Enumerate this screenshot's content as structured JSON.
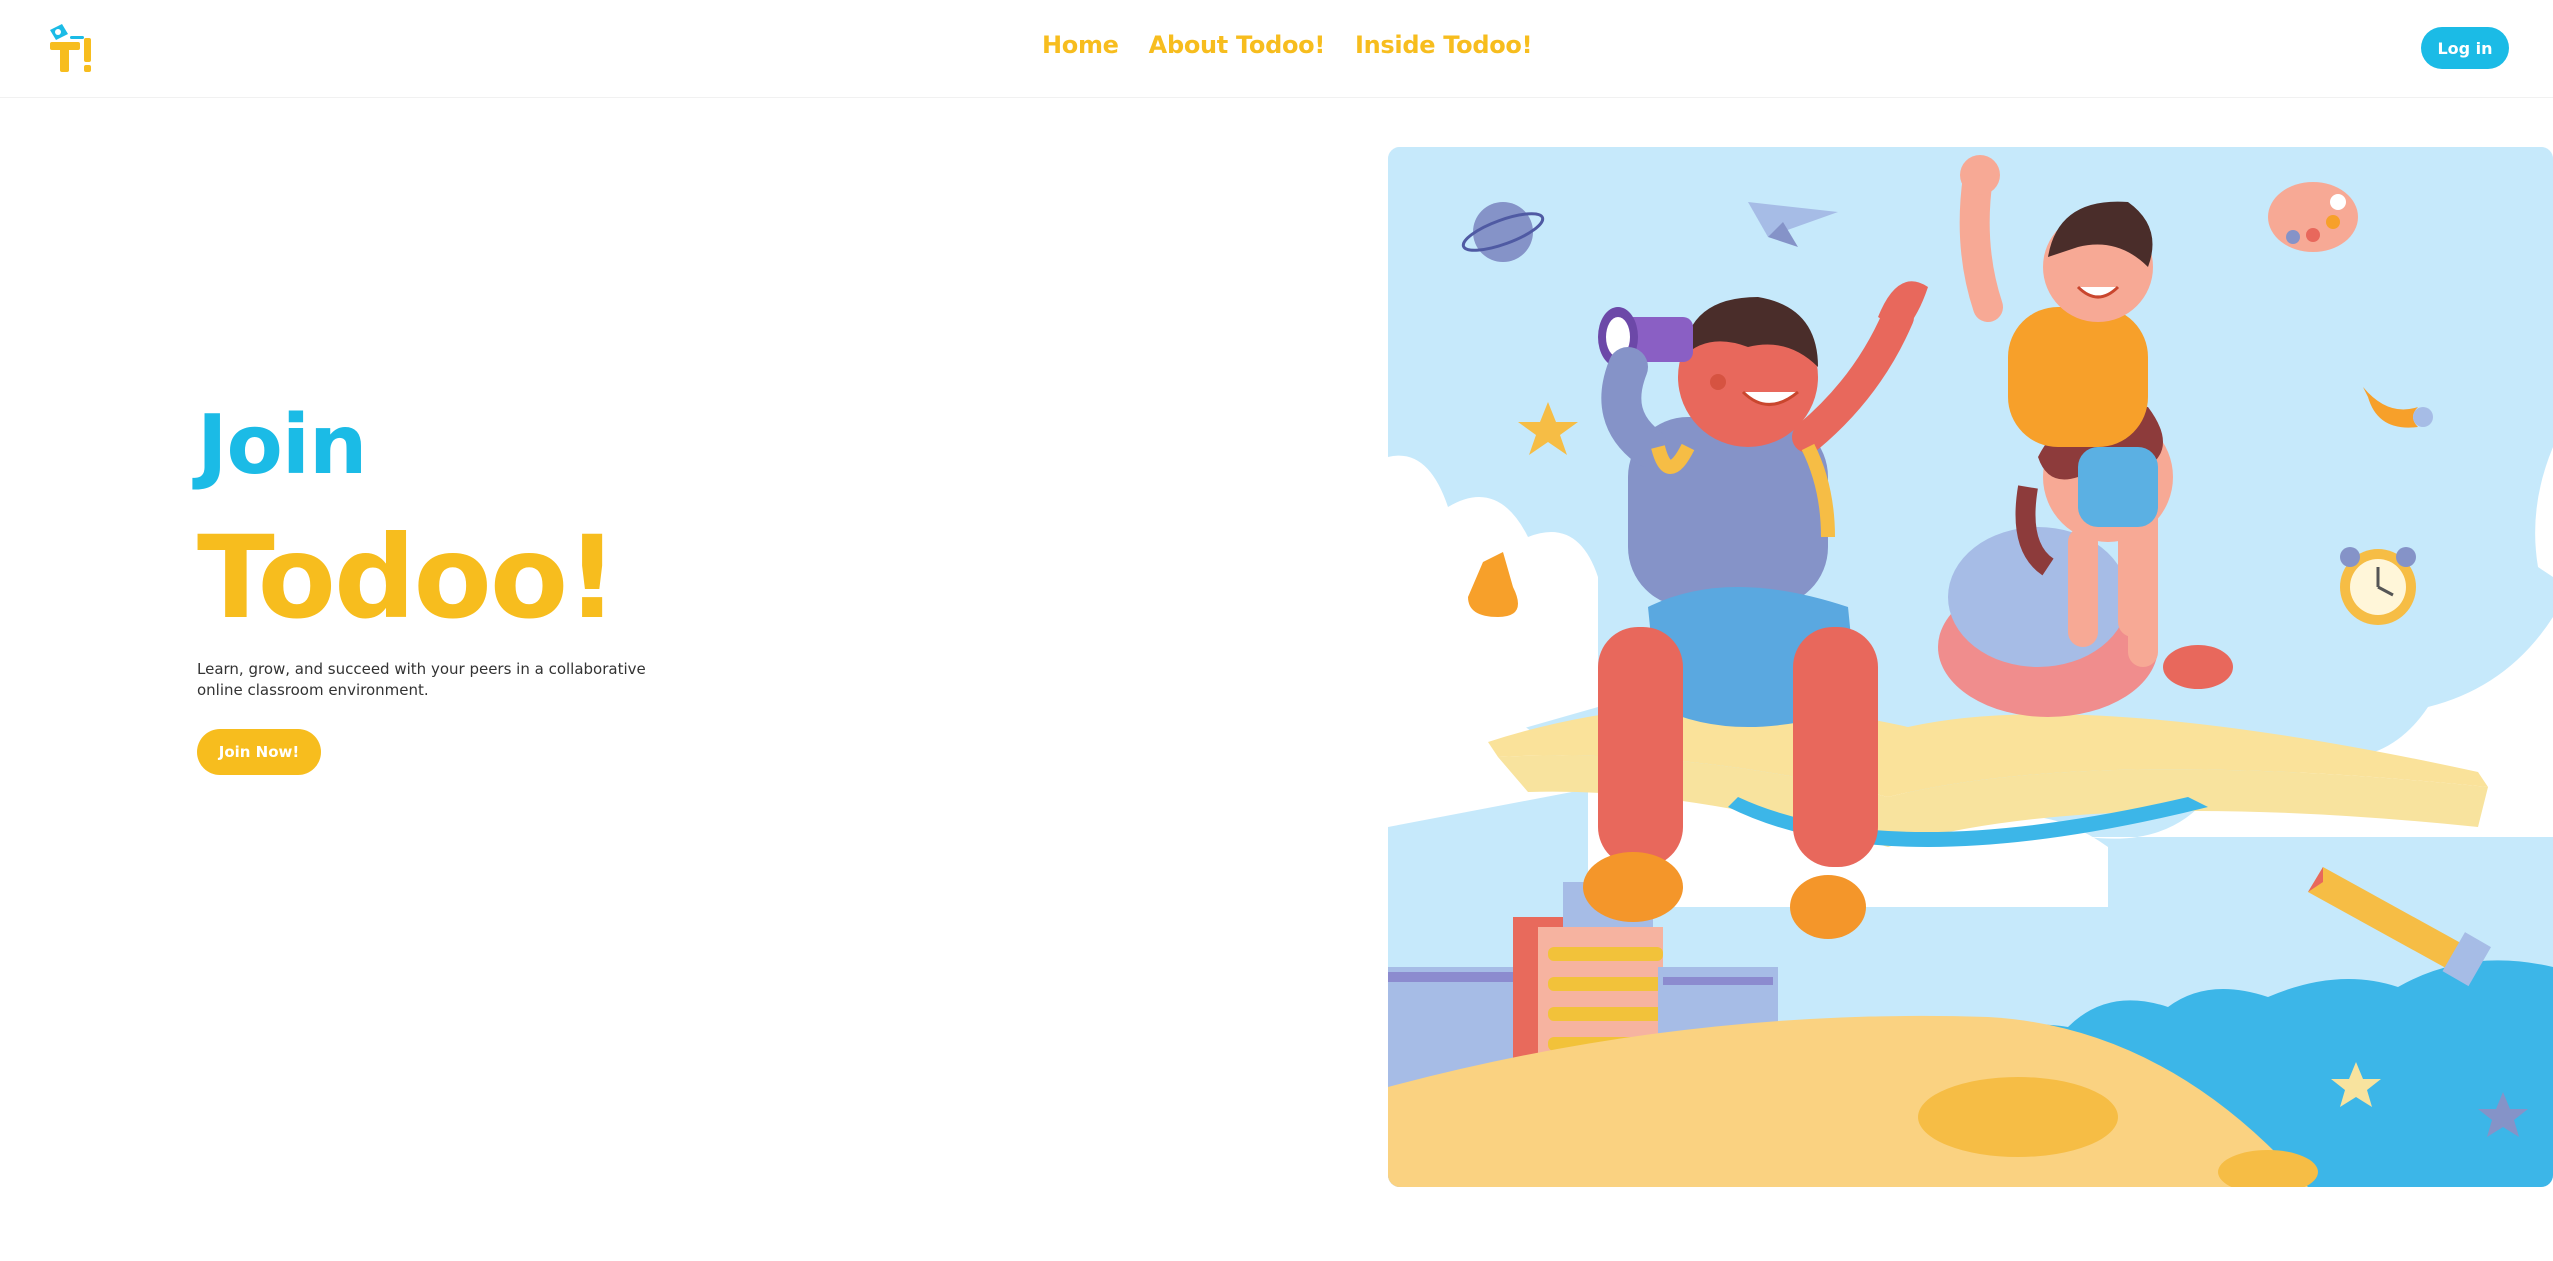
{
  "nav": {
    "logo_icon": "todoo-logo-icon",
    "links": [
      {
        "label": "Home"
      },
      {
        "label": "About Todoo!"
      },
      {
        "label": "Inside Todoo!"
      }
    ],
    "login_label": "Log in"
  },
  "hero": {
    "title_line1": "Join",
    "title_line2": "Todoo!",
    "description": "Learn, grow, and succeed with your peers in a collaborative online classroom environment.",
    "cta_label": "Join Now!"
  },
  "colors": {
    "brand_blue": "#1bbbe6",
    "brand_yellow": "#f7bd1e",
    "sky": "#c6e9fb",
    "ground": "#fad281"
  }
}
